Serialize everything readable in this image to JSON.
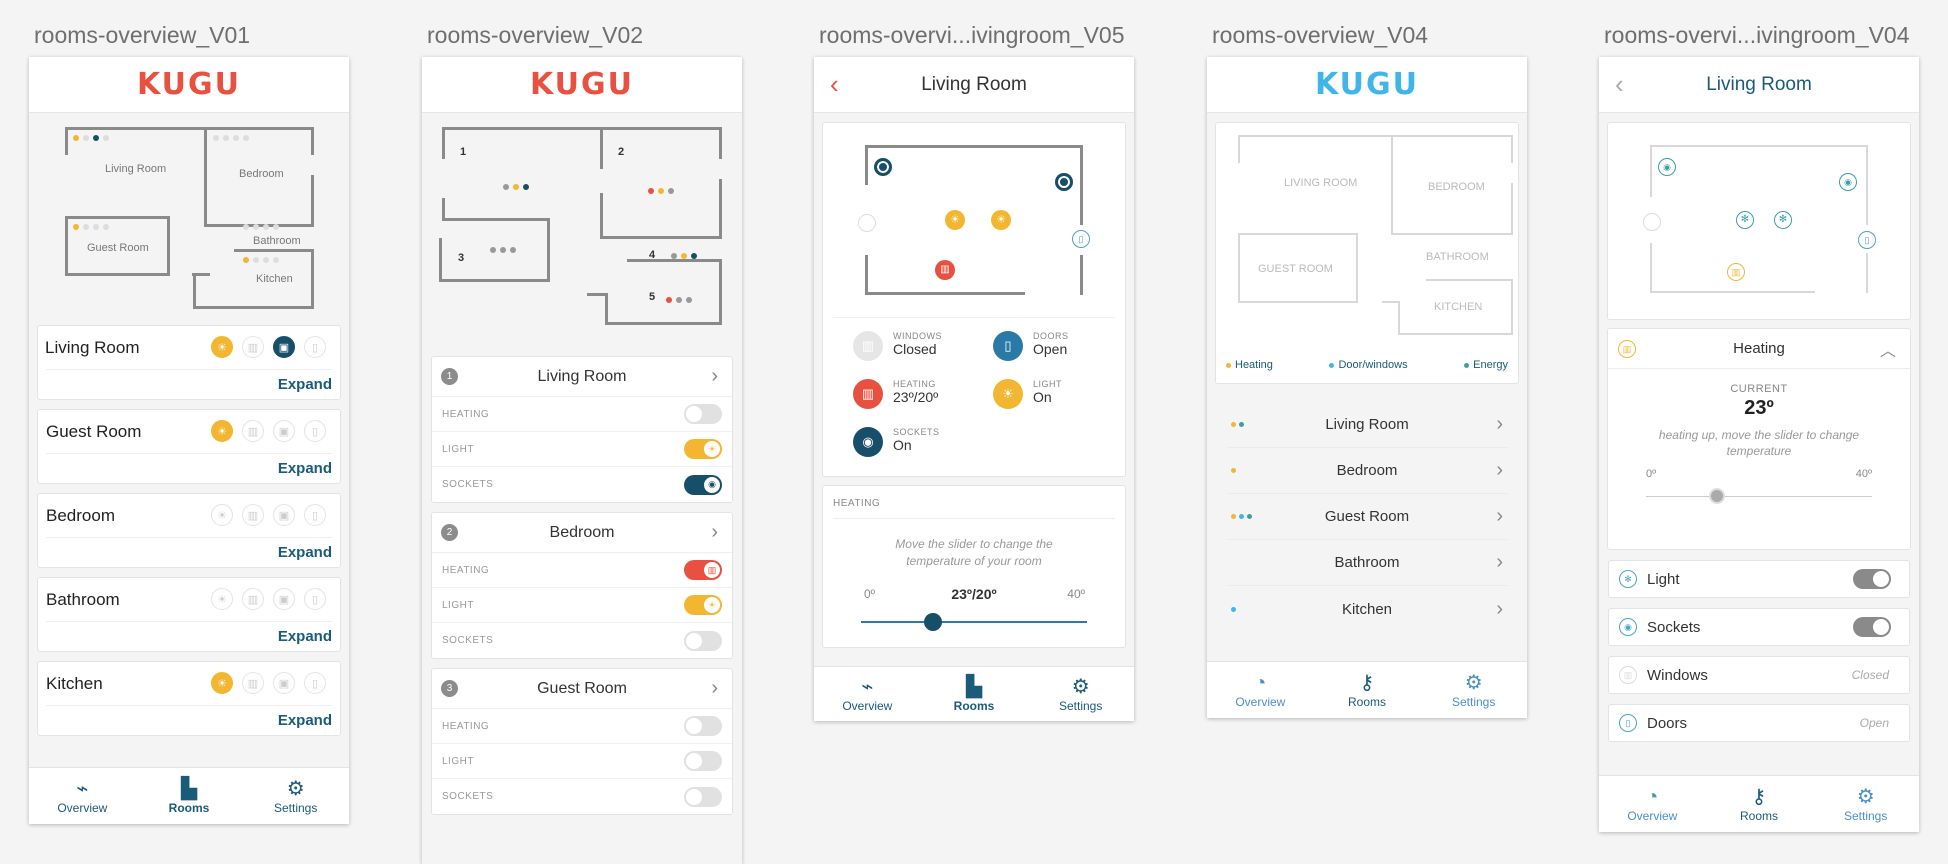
{
  "colors": {
    "kugu_red": "#e8513f",
    "kugu_blue": "#3fb5e8",
    "navy": "#174f6b",
    "yellow": "#f2b631",
    "teal": "#3a9fa8"
  },
  "artboards": [
    {
      "title": "rooms-overview_V01"
    },
    {
      "title": "rooms-overview_V02"
    },
    {
      "title": "rooms-overvi...ivingroom_V05"
    },
    {
      "title": "rooms-overview_V04"
    },
    {
      "title": "rooms-overvi...ivingroom_V04"
    }
  ],
  "logo": "KUGU",
  "v1": {
    "plan_labels": [
      "Living Room",
      "Bedroom",
      "Guest Room",
      "Bathroom",
      "Kitchen"
    ],
    "rooms": [
      {
        "name": "Living Room",
        "expand": "Expand"
      },
      {
        "name": "Guest Room",
        "expand": "Expand"
      },
      {
        "name": "Bedroom",
        "expand": "Expand"
      },
      {
        "name": "Bathroom",
        "expand": "Expand"
      },
      {
        "name": "Kitchen",
        "expand": "Expand"
      }
    ],
    "tabs": [
      "Overview",
      "Rooms",
      "Settings"
    ]
  },
  "v2": {
    "plan_numbers": [
      "1",
      "2",
      "3",
      "4",
      "5"
    ],
    "cards": [
      {
        "num": "1",
        "title": "Living Room",
        "rows": [
          "HEATING",
          "LIGHT",
          "SOCKETS"
        ]
      },
      {
        "num": "2",
        "title": "Bedroom",
        "rows": [
          "HEATING",
          "LIGHT",
          "SOCKETS"
        ]
      },
      {
        "num": "3",
        "title": "Guest Room",
        "rows": [
          "HEATING",
          "LIGHT",
          "SOCKETS"
        ]
      }
    ]
  },
  "v3": {
    "title": "Living Room",
    "stats": [
      {
        "label": "WINDOWS",
        "value": "Closed"
      },
      {
        "label": "DOORS",
        "value": "Open"
      },
      {
        "label": "HEATING",
        "value": "23º/20º"
      },
      {
        "label": "LIGHT",
        "value": "On"
      },
      {
        "label": "SOCKETS",
        "value": "On"
      }
    ],
    "heating": {
      "section": "HEATING",
      "hint": "Move the slider to change the temperature of your room",
      "min": "0º",
      "value": "23º/20º",
      "max": "40º"
    },
    "tabs": [
      "Overview",
      "Rooms",
      "Settings"
    ]
  },
  "v4": {
    "plan_labels": [
      "LIVING ROOM",
      "BEDROOM",
      "GUEST ROOM",
      "BATHROOM",
      "KITCHEN"
    ],
    "legend": [
      "Heating",
      "Door/windows",
      "Energy"
    ],
    "rooms": [
      "Living Room",
      "Bedroom",
      "Guest Room",
      "Bathroom",
      "Kitchen"
    ],
    "tabs": [
      "Overview",
      "Rooms",
      "Settings"
    ]
  },
  "v5": {
    "title": "Living Room",
    "heating": {
      "title": "Heating",
      "current_label": "CURRENT",
      "current": "23º",
      "hint": "heating up, move the slider to change temperature",
      "min": "0º",
      "max": "40º"
    },
    "rows": [
      {
        "name": "Light"
      },
      {
        "name": "Sockets"
      },
      {
        "name": "Windows",
        "value": "Closed"
      },
      {
        "name": "Doors",
        "value": "Open"
      }
    ],
    "tabs": [
      "Overview",
      "Rooms",
      "Settings"
    ]
  }
}
